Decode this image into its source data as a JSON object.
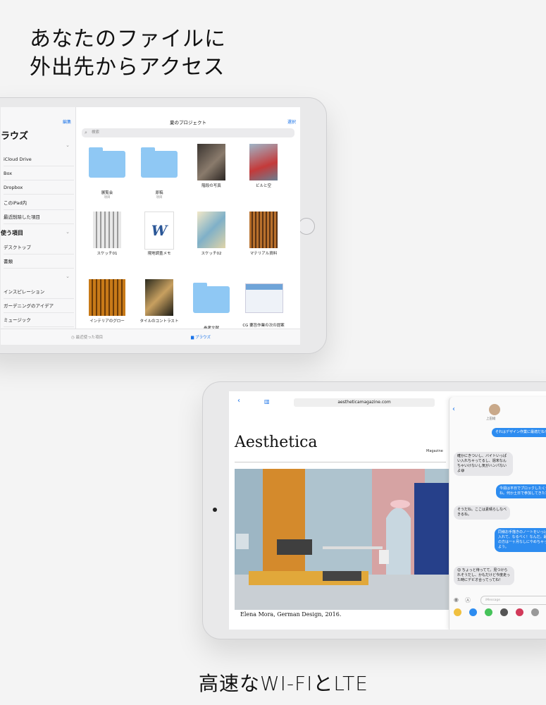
{
  "headline": {
    "line1": "あなたのファイルに",
    "line2": "外出先からアクセス",
    "bottom": "高速なWI-FIとLTE"
  },
  "files_app": {
    "sidebar": {
      "edit_label": "編集",
      "title": "ラウズ",
      "sections": [
        {
          "label": "",
          "items": [
            "iCloud Drive",
            "Box",
            "Dropbox",
            "このiPad内",
            "最近削除した項目"
          ]
        },
        {
          "label": "使う項目",
          "items": [
            "デスクトップ",
            "書類"
          ]
        },
        {
          "label": "",
          "items": [
            "インスピレーション",
            "ガーデニングのアイデア",
            "ミュージック"
          ]
        }
      ]
    },
    "main": {
      "title": "夏のプロジェクト",
      "select_label": "選択",
      "search_placeholder": "検索",
      "files": [
        {
          "name": "展覧会",
          "meta": "項目",
          "kind": "folder"
        },
        {
          "name": "原稿",
          "meta": "項目",
          "kind": "folder"
        },
        {
          "name": "階段の写真",
          "meta": "",
          "kind": "photo-dark"
        },
        {
          "name": "ビルと空",
          "meta": "",
          "kind": "photo-sky"
        },
        {
          "name": "スケッチ01",
          "meta": "",
          "kind": "sketch"
        },
        {
          "name": "現地調査メモ",
          "meta": "",
          "kind": "word"
        },
        {
          "name": "スケッチ02",
          "meta": "",
          "kind": "sketch2"
        },
        {
          "name": "マテリアル資料",
          "meta": "",
          "kind": "photo-wood"
        },
        {
          "name": "インテリアのグロー",
          "meta": "",
          "kind": "photo-amber"
        },
        {
          "name": "タイルのコントラスト",
          "meta": "",
          "kind": "photo-tile"
        },
        {
          "name": "参考文献",
          "meta": "",
          "kind": "folder"
        },
        {
          "name": "CG 要旨作業の次の提案",
          "meta": "",
          "kind": "doc"
        }
      ]
    },
    "tabbar": {
      "recent": "最近使った項目",
      "browse": "ブラウズ"
    }
  },
  "safari": {
    "url": "aestheticamagazine.com",
    "magazine_title": "Aesthetica",
    "magazine_tag": "Magazine",
    "caption": "Elena Mora, German Design, 2016."
  },
  "messages": {
    "contact": "上田綾",
    "bubbles": [
      {
        "dir": "out",
        "text": "それはデザイン作業に最適だね！"
      },
      {
        "dir": "in",
        "text": "確かにきついし、バイトいっぱい入れちゃってるし、週末なんちゃいけないし気がハンパないよ😅"
      },
      {
        "dir": "out",
        "text": "今週は平日でプロックしたくせね。何か土日で参加してきた？"
      },
      {
        "dir": "in",
        "text": "そうだね。ここは素晴らしなべきるね。"
      },
      {
        "dir": "out",
        "text": "同様お手描きのノートをいっぱい入れて、なるべく！なんだ。最後の方は一ヶ月なしにやめちゃったよう。"
      },
      {
        "dir": "in",
        "text": "😊 ちょっと待ってて。見つけられそうだし、かもだけど今度走った時にデビオ合ってってね！"
      }
    ],
    "input_placeholder": "iMessage"
  },
  "colors": {
    "accent": "#1a73e8",
    "bubble_out": "#2d8cf0",
    "folder": "#8fc8f4"
  }
}
